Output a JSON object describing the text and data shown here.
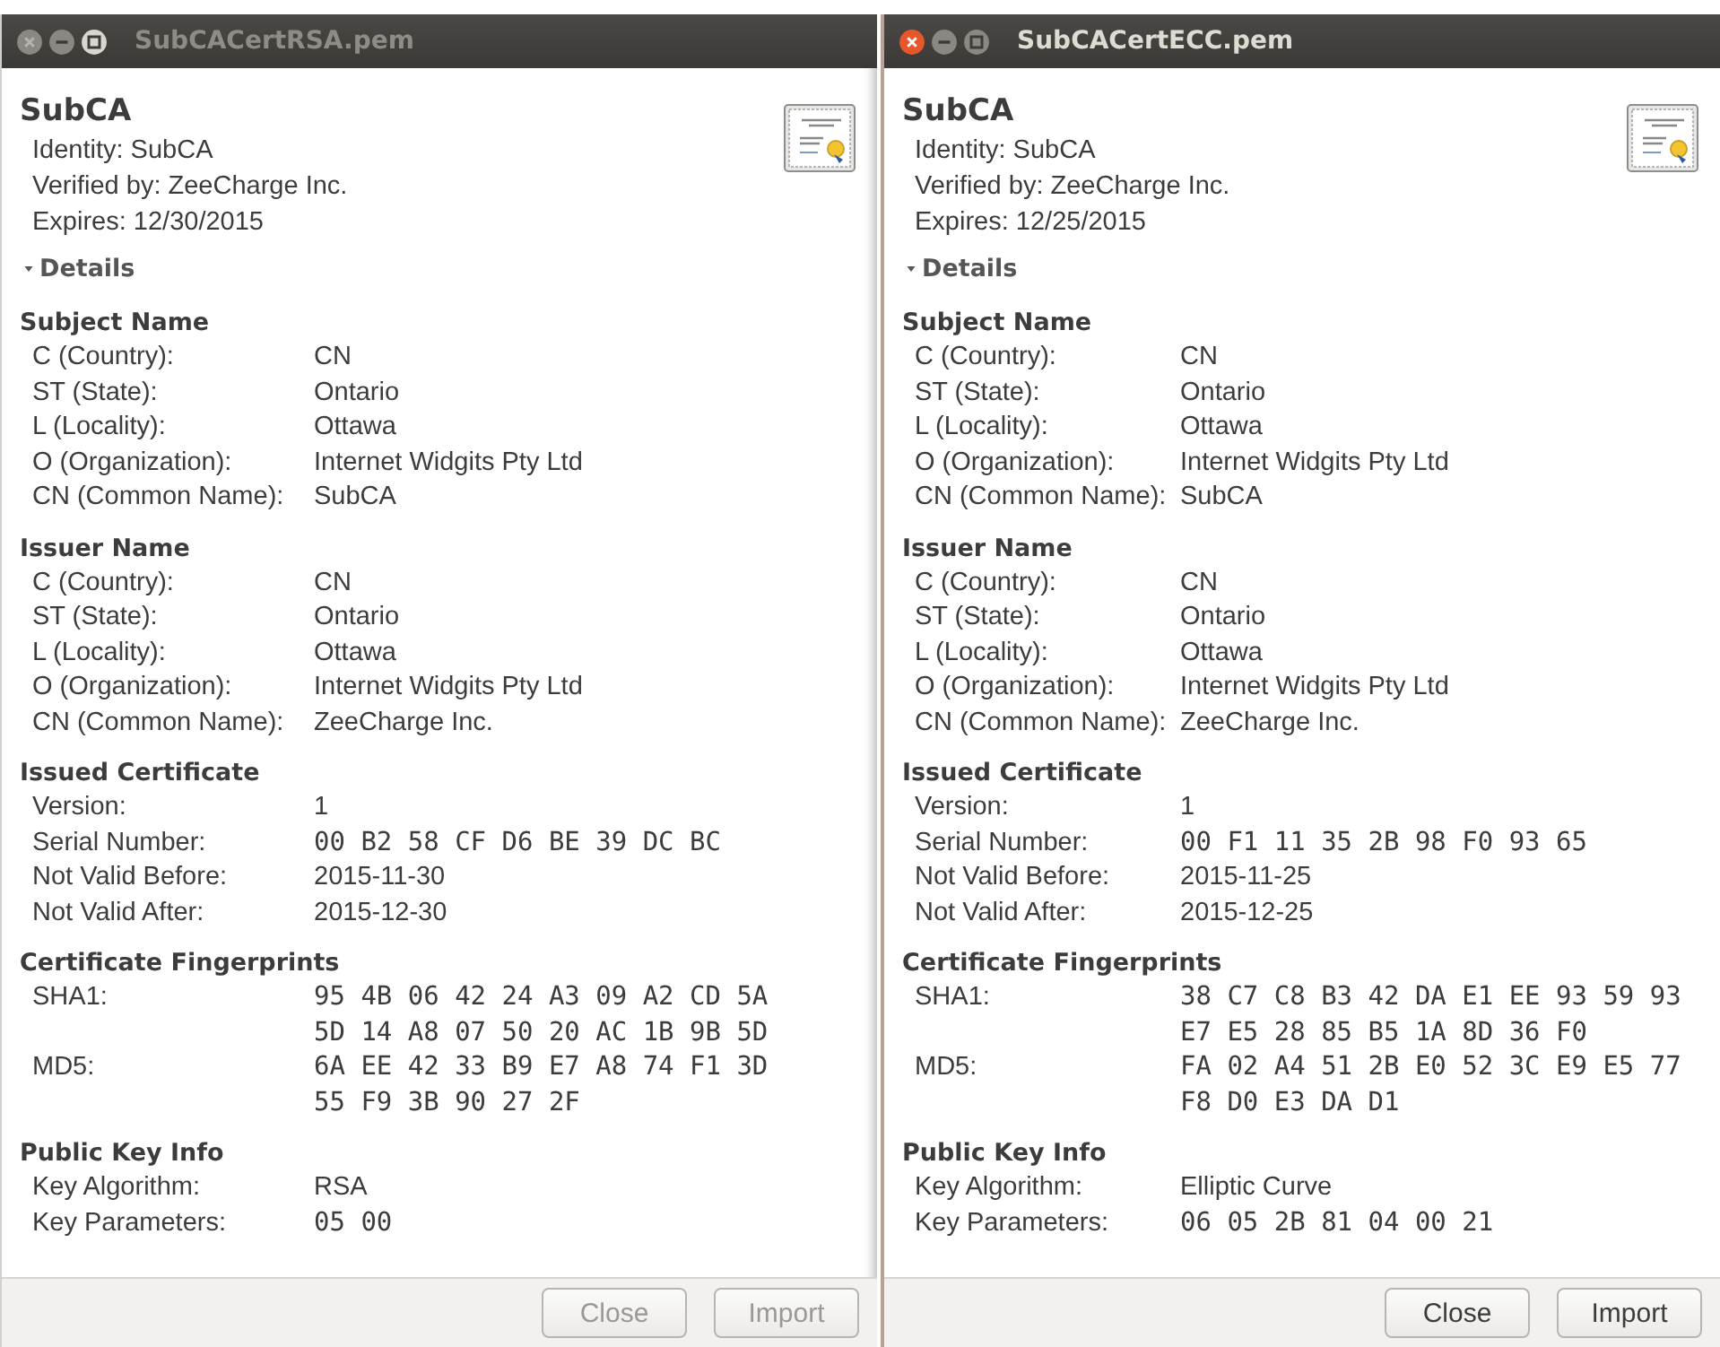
{
  "windows": [
    {
      "title": "SubCACertRSA.pem",
      "active": false,
      "heading": "SubCA",
      "identity": "Identity: SubCA",
      "verified_by": "Verified by: ZeeCharge Inc.",
      "expires": "Expires: 12/30/2015",
      "details": {
        "label": "Details",
        "expanded": true
      },
      "sections": [
        {
          "title": "Subject Name",
          "rows": [
            {
              "label": "C (Country):",
              "kind": "text",
              "values": [
                "CN"
              ]
            },
            {
              "label": "ST (State):",
              "kind": "text",
              "values": [
                "Ontario"
              ]
            },
            {
              "label": "L (Locality):",
              "kind": "text",
              "values": [
                "Ottawa"
              ]
            },
            {
              "label": "O (Organization):",
              "kind": "text",
              "values": [
                "Internet Widgits Pty Ltd"
              ]
            },
            {
              "label": "CN (Common Name):",
              "kind": "text",
              "values": [
                "SubCA"
              ]
            }
          ]
        },
        {
          "title": "Issuer Name",
          "rows": [
            {
              "label": "C (Country):",
              "kind": "text",
              "values": [
                "CN"
              ]
            },
            {
              "label": "ST (State):",
              "kind": "text",
              "values": [
                "Ontario"
              ]
            },
            {
              "label": "L (Locality):",
              "kind": "text",
              "values": [
                "Ottawa"
              ]
            },
            {
              "label": "O (Organization):",
              "kind": "text",
              "values": [
                "Internet Widgits Pty Ltd"
              ]
            },
            {
              "label": "CN (Common Name):",
              "kind": "text",
              "values": [
                "ZeeCharge Inc."
              ]
            }
          ]
        },
        {
          "title": "Issued Certificate",
          "rows": [
            {
              "label": "Version:",
              "kind": "text",
              "values": [
                "1"
              ]
            },
            {
              "label": "Serial Number:",
              "kind": "mono",
              "values": [
                "00 B2 58 CF D6 BE 39 DC BC"
              ]
            },
            {
              "label": "Not Valid Before:",
              "kind": "text",
              "values": [
                "2015-11-30"
              ]
            },
            {
              "label": "Not Valid After:",
              "kind": "text",
              "values": [
                "2015-12-30"
              ]
            }
          ]
        },
        {
          "title": "Certificate Fingerprints",
          "rows": [
            {
              "label": "SHA1:",
              "kind": "mono",
              "values": [
                "95 4B 06 42 24 A3 09 A2 CD 5A",
                "5D 14 A8 07 50 20 AC 1B 9B 5D"
              ]
            },
            {
              "label": "MD5:",
              "kind": "mono",
              "values": [
                "6A EE 42 33 B9 E7 A8 74 F1 3D",
                "55 F9 3B 90 27 2F"
              ]
            }
          ]
        },
        {
          "title": "Public Key Info",
          "rows": [
            {
              "label": "Key Algorithm:",
              "kind": "text",
              "values": [
                "RSA"
              ]
            },
            {
              "label": "Key Parameters:",
              "kind": "mono",
              "values": [
                "05 00"
              ]
            }
          ]
        }
      ],
      "buttons": [
        "Close",
        "Import"
      ]
    },
    {
      "title": "SubCACertECC.pem",
      "active": true,
      "heading": "SubCA",
      "identity": "Identity: SubCA",
      "verified_by": "Verified by: ZeeCharge Inc.",
      "expires": "Expires: 12/25/2015",
      "details": {
        "label": "Details",
        "expanded": true
      },
      "sections": [
        {
          "title": "Subject Name",
          "rows": [
            {
              "label": "C (Country):",
              "kind": "text",
              "values": [
                "CN"
              ]
            },
            {
              "label": "ST (State):",
              "kind": "text",
              "values": [
                "Ontario"
              ]
            },
            {
              "label": "L (Locality):",
              "kind": "text",
              "values": [
                "Ottawa"
              ]
            },
            {
              "label": "O (Organization):",
              "kind": "text",
              "values": [
                "Internet Widgits Pty Ltd"
              ]
            },
            {
              "label": "CN (Common Name):",
              "kind": "text",
              "values": [
                "SubCA"
              ]
            }
          ]
        },
        {
          "title": "Issuer Name",
          "rows": [
            {
              "label": "C (Country):",
              "kind": "text",
              "values": [
                "CN"
              ]
            },
            {
              "label": "ST (State):",
              "kind": "text",
              "values": [
                "Ontario"
              ]
            },
            {
              "label": "L (Locality):",
              "kind": "text",
              "values": [
                "Ottawa"
              ]
            },
            {
              "label": "O (Organization):",
              "kind": "text",
              "values": [
                "Internet Widgits Pty Ltd"
              ]
            },
            {
              "label": "CN (Common Name):",
              "kind": "text",
              "values": [
                "ZeeCharge Inc."
              ]
            }
          ]
        },
        {
          "title": "Issued Certificate",
          "rows": [
            {
              "label": "Version:",
              "kind": "text",
              "values": [
                "1"
              ]
            },
            {
              "label": "Serial Number:",
              "kind": "mono",
              "values": [
                "00 F1 11 35 2B 98 F0 93 65"
              ]
            },
            {
              "label": "Not Valid Before:",
              "kind": "text",
              "values": [
                "2015-11-25"
              ]
            },
            {
              "label": "Not Valid After:",
              "kind": "text",
              "values": [
                "2015-12-25"
              ]
            }
          ]
        },
        {
          "title": "Certificate Fingerprints",
          "rows": [
            {
              "label": "SHA1:",
              "kind": "mono",
              "values": [
                "38 C7 C8 B3 42 DA E1 EE 93 59 93",
                "E7 E5 28 85 B5 1A 8D 36 F0"
              ]
            },
            {
              "label": "MD5:",
              "kind": "mono",
              "values": [
                "FA 02 A4 51 2B E0 52 3C E9 E5 77",
                "F8 D0 E3 DA D1"
              ]
            }
          ]
        },
        {
          "title": "Public Key Info",
          "rows": [
            {
              "label": "Key Algorithm:",
              "kind": "text",
              "values": [
                "Elliptic Curve"
              ]
            },
            {
              "label": "Key Parameters:",
              "kind": "mono",
              "values": [
                "06 05 2B 81 04 00 21"
              ]
            }
          ]
        }
      ],
      "buttons": [
        "Close",
        "Import"
      ]
    }
  ]
}
